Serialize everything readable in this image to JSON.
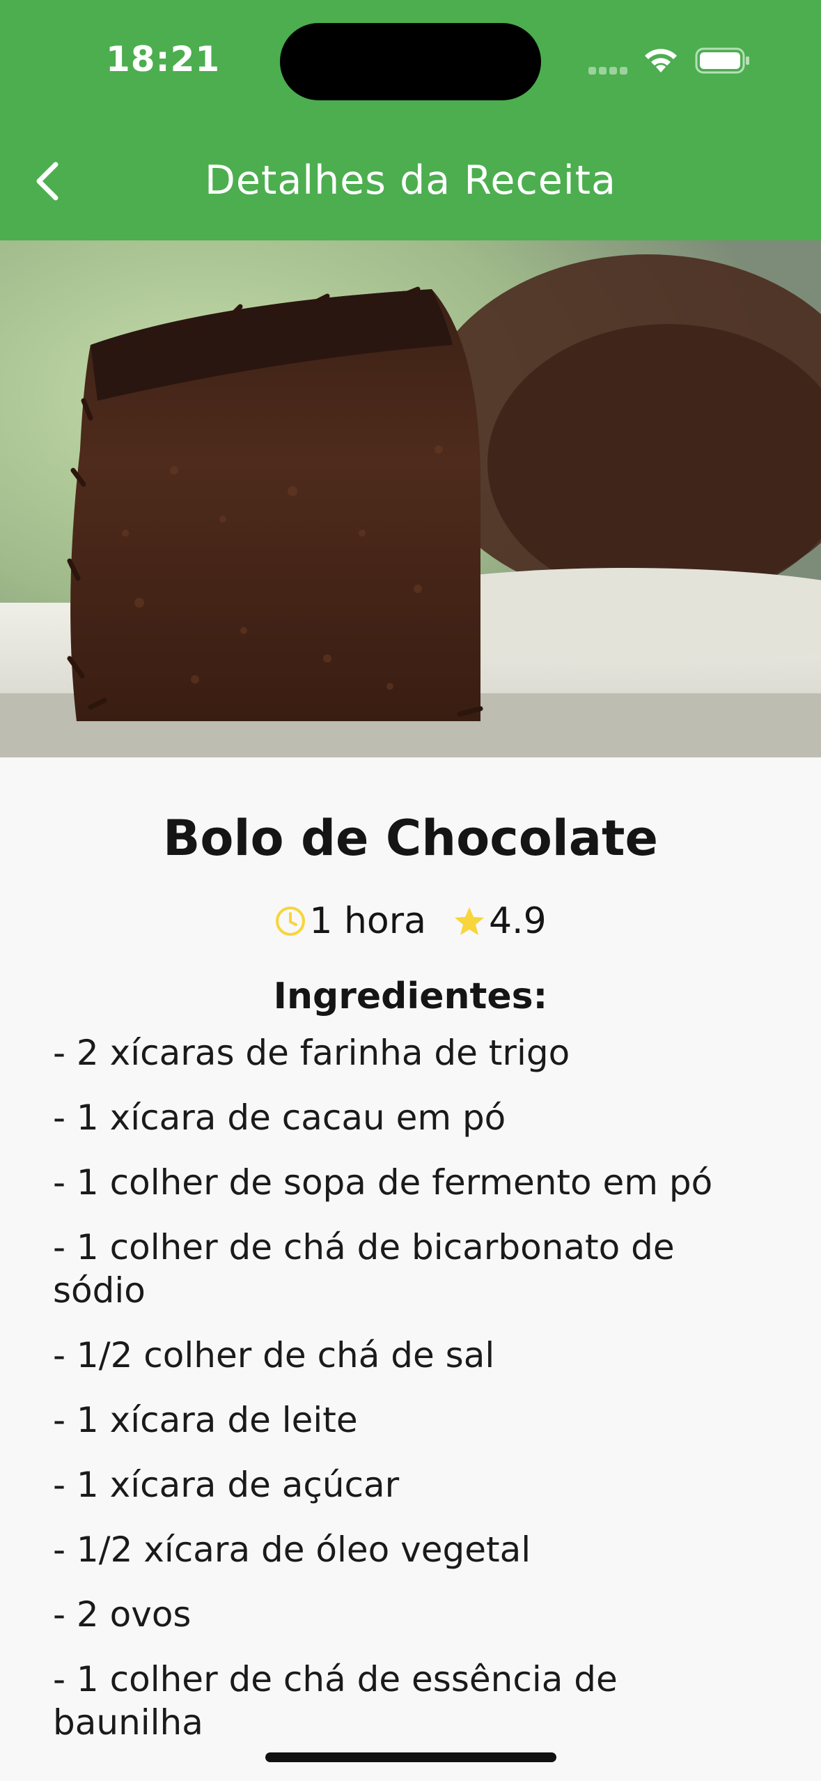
{
  "status_bar": {
    "time": "18:21"
  },
  "nav": {
    "title": "Detalhes da Receita",
    "back_icon": "chevron-left-icon"
  },
  "recipe": {
    "name": "Bolo de Chocolate",
    "time": "1 hora",
    "rating": "4.9",
    "ingredients_heading": "Ingredientes:",
    "ingredients": [
      "- 2 xícaras de farinha de trigo",
      "- 1 xícara de cacau em pó",
      "- 1 colher de sopa de fermento em pó",
      "- 1 colher de chá de bicarbonato de sódio",
      "- 1/2 colher de chá de sal",
      "- 1 xícara de leite",
      "- 1 xícara de açúcar",
      "- 1/2 xícara de óleo vegetal",
      "- 2 ovos",
      "- 1 colher de chá de essência de baunilha"
    ]
  },
  "colors": {
    "header": "#4cae4f",
    "accent": "#f7d53b",
    "background": "#f8f8f8"
  }
}
